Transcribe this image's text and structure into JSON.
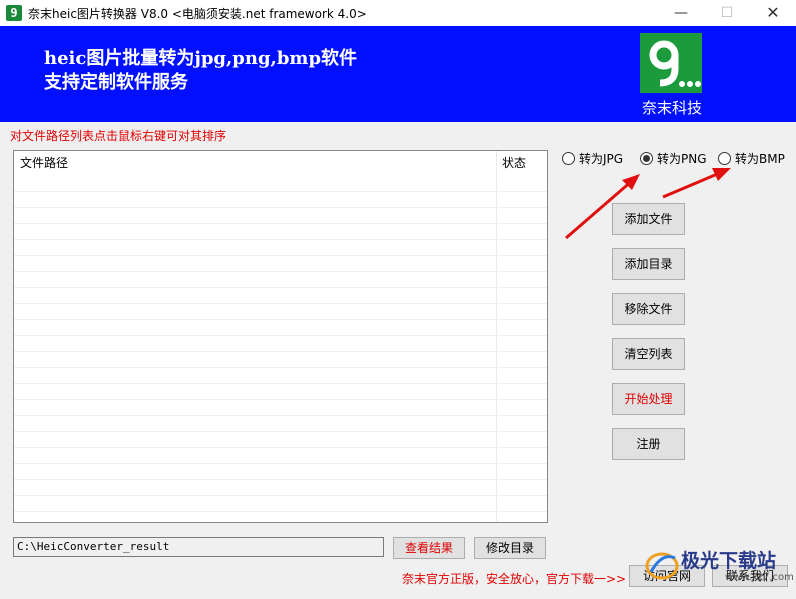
{
  "window": {
    "icon_glyph": "9",
    "title": "奈末heic图片转换器 V8.0 <电脑须安装.net framework 4.0>",
    "minimize": "—",
    "maximize": "☐",
    "close": "✕"
  },
  "banner": {
    "line1": "heic图片批量转为jpg,png,bmp软件",
    "line2": "支持定制软件服务",
    "logo_caption": "奈末科技",
    "background": "#0010ff",
    "logo_color": "#1b9b3c"
  },
  "hint": "对文件路径列表点击鼠标右键可对其排序",
  "list": {
    "columns": [
      "文件路径",
      "状态"
    ],
    "rows": []
  },
  "formats": {
    "options": [
      "转为JPG",
      "转为PNG",
      "转为BMP"
    ],
    "selected": "转为PNG"
  },
  "actions": {
    "add_file": "添加文件",
    "add_dir": "添加目录",
    "remove_file": "移除文件",
    "clear_list": "清空列表",
    "start": "开始处理",
    "register": "注册"
  },
  "output": {
    "path": "C:\\HeicConverter_result",
    "view_result": "查看结果",
    "change_dir": "修改目录"
  },
  "footer": {
    "promo": "奈末官方正版，安全放心，官方下载一>>",
    "visit_site": "访问官网",
    "contact": "联系我们"
  },
  "watermark": {
    "name": "极光下载站",
    "url": "www.xz7.com"
  },
  "colors": {
    "accent_red": "#e00000",
    "arrow_red": "#e01010"
  }
}
